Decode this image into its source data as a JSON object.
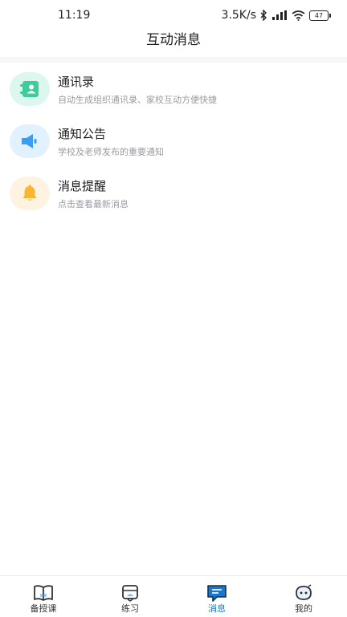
{
  "status_bar": {
    "time": "11:19",
    "network_speed": "3.5K/s",
    "battery_level": "47",
    "icons": [
      "bluetooth-icon",
      "signal-icon",
      "wifi-icon",
      "battery-icon"
    ]
  },
  "header": {
    "title": "互动消息"
  },
  "messages": [
    {
      "title": "通讯录",
      "subtitle": "自动生成组织通讯录、家校互动方便快捷",
      "icon": "contacts-icon",
      "color": "#3dcc9a"
    },
    {
      "title": "通知公告",
      "subtitle": "学校及老师发布的重要通知",
      "icon": "megaphone-icon",
      "color": "#3b9cf0"
    },
    {
      "title": "消息提醒",
      "subtitle": "点击查看最新消息",
      "icon": "bell-icon",
      "color": "#f7b733"
    }
  ],
  "tabs": [
    {
      "label": "备授课",
      "icon": "book-icon",
      "active": false
    },
    {
      "label": "练习",
      "icon": "practice-icon",
      "active": false
    },
    {
      "label": "消息",
      "icon": "message-icon",
      "active": true
    },
    {
      "label": "我的",
      "icon": "profile-icon",
      "active": false
    }
  ],
  "colors": {
    "accent": "#1877c9",
    "divider": "#f5f6f8",
    "subtitle": "#9a9aa2"
  }
}
